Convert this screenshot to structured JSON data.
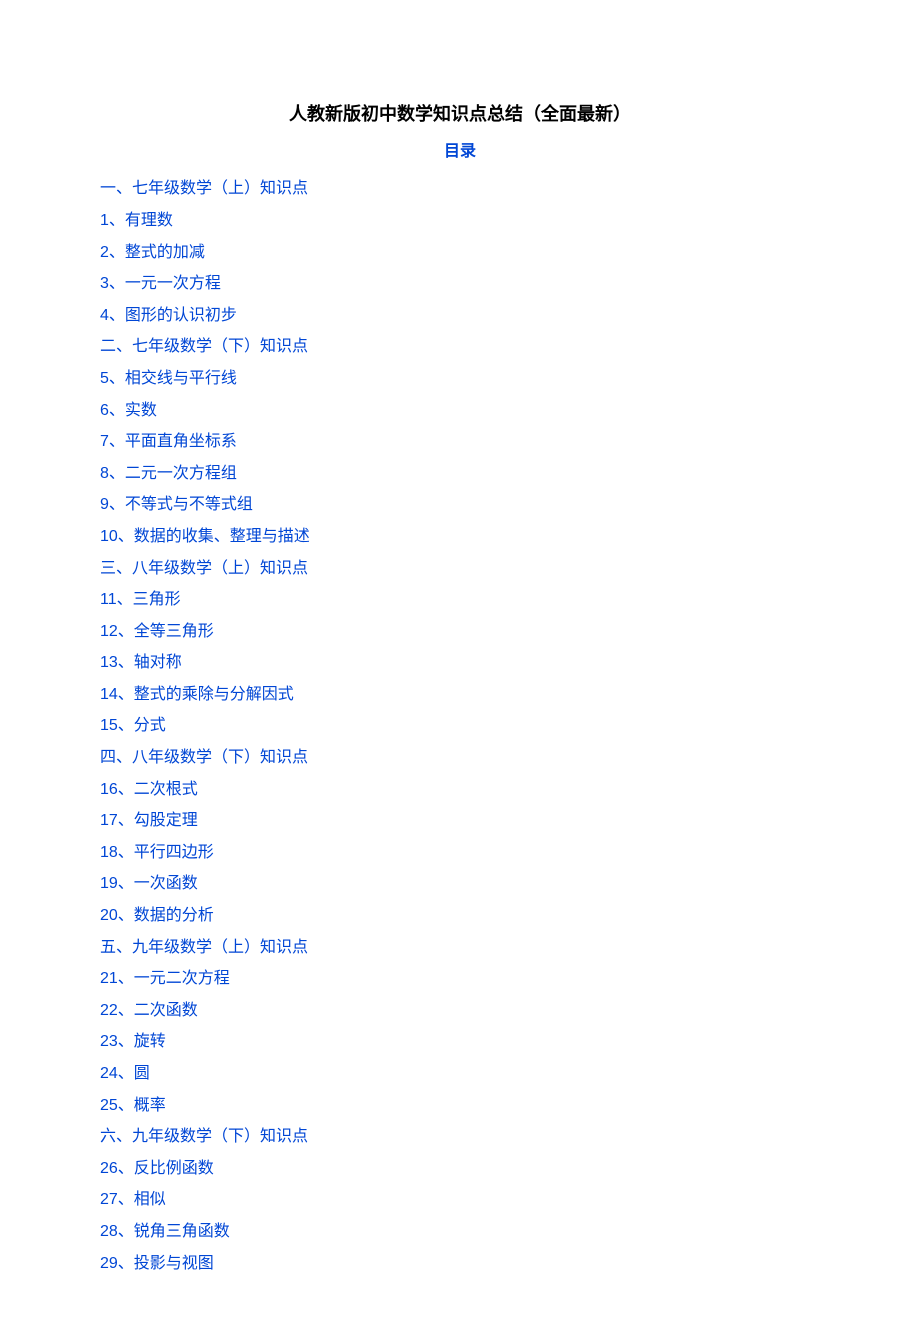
{
  "title": "人教新版初中数学知识点总结（全面最新）",
  "toc_heading": "目录",
  "toc_items": [
    "一、七年级数学（上）知识点",
    "1、有理数",
    "2、整式的加减",
    "3、一元一次方程",
    "4、图形的认识初步",
    "二、七年级数学（下）知识点",
    "5、相交线与平行线",
    "6、实数",
    "7、平面直角坐标系",
    "8、二元一次方程组",
    "9、不等式与不等式组",
    "10、数据的收集、整理与描述",
    "三、八年级数学（上）知识点",
    "11、三角形",
    "12、全等三角形",
    "13、轴对称",
    "14、整式的乘除与分解因式",
    "15、分式",
    "四、八年级数学（下）知识点",
    "16、二次根式",
    "17、勾股定理",
    "18、平行四边形",
    "19、一次函数",
    "20、数据的分析",
    "五、九年级数学（上）知识点",
    "21、一元二次方程",
    "22、二次函数",
    "23、旋转",
    "24、圆",
    "25、概率",
    "六、九年级数学（下）知识点",
    "26、反比例函数",
    "27、相似",
    "28、锐角三角函数",
    "29、投影与视图"
  ]
}
